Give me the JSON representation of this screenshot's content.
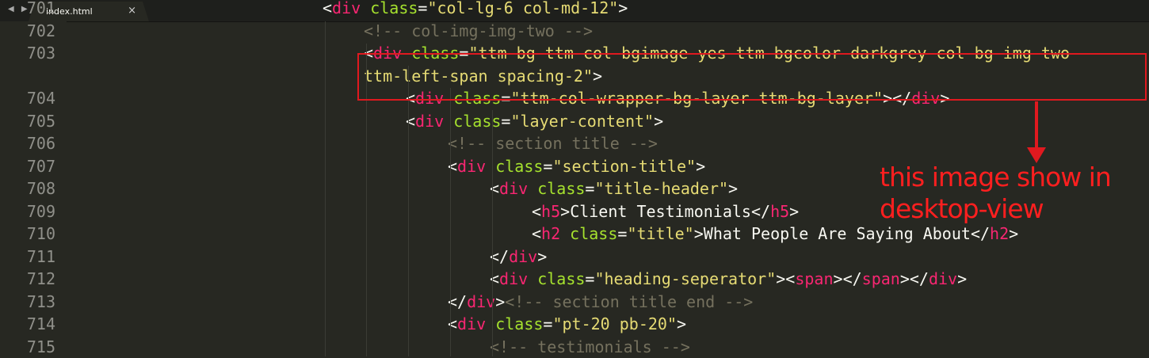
{
  "tab": {
    "title": "index.html",
    "close": "×",
    "nav": "◀ ▶"
  },
  "lines": [
    {
      "num": "701",
      "code": "<div class=\"col-lg-6 col-md-12\">"
    },
    {
      "num": "702",
      "code": "<!-- col-img-img-two -->"
    },
    {
      "num": "703",
      "code": "<div class=\"ttm-bg ttm-col-bgimage-yes ttm-bgcolor-darkgrey col-bg-img-two"
    },
    {
      "num": "",
      "code": "ttm-left-span spacing-2\">"
    },
    {
      "num": "704",
      "code": "<div class=\"ttm-col-wrapper-bg-layer ttm-bg-layer\"></div>"
    },
    {
      "num": "705",
      "code": "<div class=\"layer-content\">"
    },
    {
      "num": "706",
      "code": "<!-- section title -->"
    },
    {
      "num": "707",
      "code": "<div class=\"section-title\">"
    },
    {
      "num": "708",
      "code": "<div class=\"title-header\">"
    },
    {
      "num": "709",
      "code": "<h5>Client Testimonials</h5>"
    },
    {
      "num": "710",
      "code": "<h2 class=\"title\">What People Are Saying About</h2>"
    },
    {
      "num": "711",
      "code": "</div>"
    },
    {
      "num": "712",
      "code": "<div class=\"heading-seperator\"><span></span></div>"
    },
    {
      "num": "713",
      "code": "</div><!-- section title end -->"
    },
    {
      "num": "714",
      "code": "<div class=\"pt-20 pb-20\">"
    },
    {
      "num": "715",
      "code": "<!-- testimonials -->"
    }
  ],
  "annotation": {
    "line1": "this image show in",
    "line2": "desktop-view"
  },
  "colors": {
    "background": "#272822",
    "tag": "#f92672",
    "attr": "#a6e22e",
    "string": "#e6db74",
    "comment": "#75715e",
    "annotation": "#ff1f1f"
  }
}
